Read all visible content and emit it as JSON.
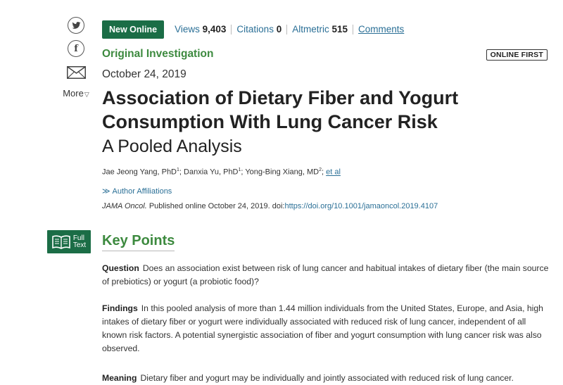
{
  "share": {
    "twitter_glyph": "🐦",
    "facebook_glyph": "f",
    "more_label": "More",
    "more_chevron": "▽"
  },
  "topbar": {
    "badge": "New Online",
    "views_label": "Views",
    "views_value": "9,403",
    "citations_label": "Citations",
    "citations_value": "0",
    "altmetric_label": "Altmetric",
    "altmetric_value": "515",
    "comments_label": "Comments"
  },
  "article": {
    "section": "Original Investigation",
    "online_first": "ONLINE FIRST",
    "date": "October 24, 2019",
    "title": "Association of Dietary Fiber and Yogurt Consumption With Lung Cancer Risk",
    "subtitle": "A Pooled Analysis",
    "authors": [
      {
        "name": "Jae Jeong Yang, PhD",
        "sup": "1"
      },
      {
        "name": "Danxia Yu, PhD",
        "sup": "1"
      },
      {
        "name": "Yong-Bing Xiang, MD",
        "sup": "2"
      }
    ],
    "etal": "et al",
    "affiliations_label": "Author Affiliations",
    "journal": "JAMA Oncol.",
    "published_text": " Published online October 24, 2019. doi:",
    "doi": "https://doi.org/10.1001/jamaoncol.2019.4107"
  },
  "full_text_button": {
    "line1": "Full",
    "line2": "Text"
  },
  "key_points": {
    "title": "Key Points",
    "question_label": "Question",
    "question_text": "Does an association exist between risk of lung cancer and habitual intakes of dietary fiber (the main source of prebiotics) or yogurt (a probiotic food)?",
    "findings_label": "Findings",
    "findings_text": "In this pooled analysis of more than 1.44 million individuals from the United States, Europe, and Asia, high intakes of dietary fiber or yogurt were individually associated with reduced risk of lung cancer, independent of all known risk factors. A potential synergistic association of fiber and yogurt consumption with lung cancer risk was also observed.",
    "meaning_label": "Meaning",
    "meaning_text": "Dietary fiber and yogurt may be individually and jointly associated with reduced risk of lung cancer."
  },
  "colors": {
    "brand_green": "#1b6d46",
    "heading_green": "#3d8a3f",
    "link_blue": "#2a6f96"
  }
}
